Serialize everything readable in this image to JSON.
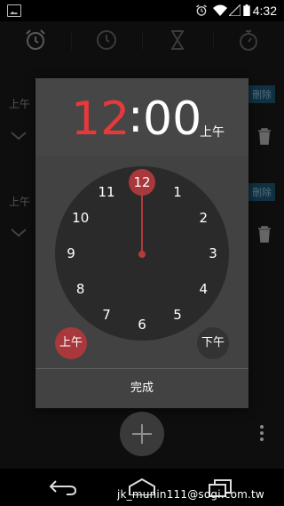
{
  "status_bar": {
    "time": "4:32"
  },
  "tabs": [
    {
      "icon": "alarm-clock-icon",
      "active": true
    },
    {
      "icon": "clock-icon",
      "active": false
    },
    {
      "icon": "hourglass-icon",
      "active": false
    },
    {
      "icon": "stopwatch-icon",
      "active": false
    }
  ],
  "background_list": {
    "items": [
      {
        "ampm": "上午",
        "badge": "刪除"
      },
      {
        "ampm": "上午",
        "badge": "刪除"
      }
    ]
  },
  "time_picker": {
    "hour": "12",
    "separator": ":",
    "minute": "00",
    "ampm": "上午",
    "clock_numbers": [
      "12",
      "1",
      "2",
      "3",
      "4",
      "5",
      "6",
      "7",
      "8",
      "9",
      "10",
      "11"
    ],
    "am_label": "上午",
    "pm_label": "下午",
    "done_label": "完成",
    "accent_color": "#e5393c"
  },
  "watermark": "jk_munin111@sogi.com.tw"
}
